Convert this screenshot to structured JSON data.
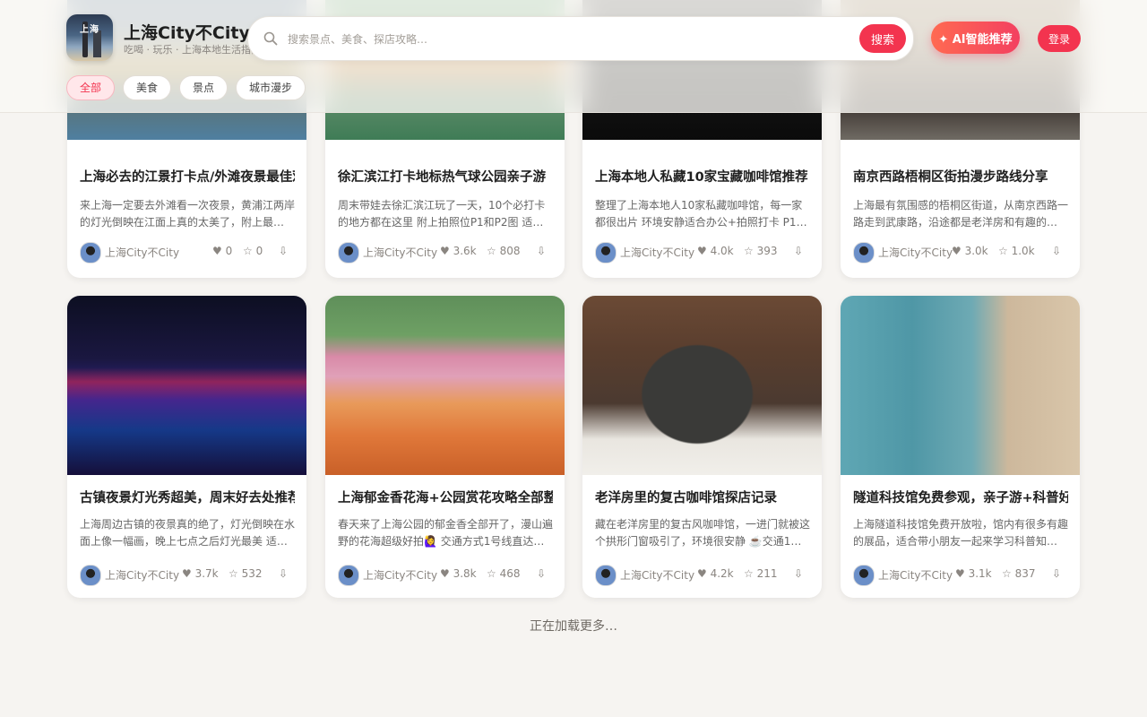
{
  "header": {
    "logo_text": "上海",
    "title": "上海City不City",
    "subtitle": "吃喝 · 玩乐 · 上海本地生活指南",
    "search_placeholder": "搜索景点、美食、探店攻略…",
    "search_button": "搜索",
    "ai_button": "✦ AI智能推荐",
    "login_button": "登录"
  },
  "chips": [
    {
      "label": "全部",
      "active": true
    },
    {
      "label": "美食"
    },
    {
      "label": "景点"
    },
    {
      "label": "城市漫步"
    }
  ],
  "colors": {
    "accent": "#f3344f",
    "background": "#f6f4f1"
  },
  "cards": [
    {
      "title": "上海必去的江景打卡点/外滩夜景最佳观景位",
      "desc": "来上海一定要去外滩看一次夜景，黄浦江两岸的灯光倒映在江面上真的太美了，附上最佳拍照机位和游玩路线，建议傍晚时分前往…",
      "author": "上海City不City",
      "likes": "♥ 0",
      "favs": "☆ 0",
      "download": "⇩"
    },
    {
      "title": "徐汇滨江打卡地标热气球公园亲子游",
      "desc": "周末带娃去徐汇滨江玩了一天，10个必打卡的地方都在这里 附上拍照位P1和P2图 适合所有人，545路 …",
      "author": "上海City不City",
      "likes": "♥ 3.6k",
      "favs": "☆ 808",
      "download": "⇩"
    },
    {
      "title": "上海本地人私藏10家宝藏咖啡馆推荐",
      "desc": "整理了上海本地人10家私藏咖啡馆，每一家都很出片 环境安静适合办公+拍照打卡 P1-P2 详细地址见图片 人均…",
      "author": "上海City不City",
      "likes": "♥ 4.0k",
      "favs": "☆ 393",
      "download": "⇩"
    },
    {
      "title": "南京西路梧桐区街拍漫步路线分享",
      "desc": "上海最有氛围感的梧桐区街道，从南京西路一路走到武康路，沿途都是老洋房和有趣的小店，非常适合周末慢慢逛，附上详细路线…",
      "author": "上海City不City",
      "likes": "♥ 3.0k",
      "favs": "☆ 1.0k",
      "download": "⇩"
    },
    {
      "title": "古镇夜景灯光秀超美，周末好去处推荐",
      "desc": "上海周边古镇的夜景真的绝了，灯光倒映在水面上像一幅画，晚上七点之后灯光最美 适合情侣约会+拍照打卡，门票…",
      "author": "上海City不City",
      "likes": "♥ 3.7k",
      "favs": "☆ 532",
      "download": "⇩"
    },
    {
      "title": "上海郁金香花海+公园赏花攻略全部整理好了",
      "desc": "春天来了上海公园的郁金香全部开了，漫山遍野的花海超级好拍🙋‍♀️ 交通方式1号线直达，2号线 P1P2 附拍照机位…",
      "author": "上海City不City",
      "likes": "♥ 3.8k",
      "favs": "☆ 468",
      "download": "⇩"
    },
    {
      "title": "老洋房里的复古咖啡馆探店记录",
      "desc": "藏在老洋房里的复古风咖啡馆，一进门就被这个拱形门窗吸引了，环境很安静 ☕️交通1号线陕西南路站，2号线 P1-P…",
      "author": "上海City不City",
      "likes": "♥ 4.2k",
      "favs": "☆ 211",
      "download": "⇩"
    },
    {
      "title": "隧道科技馆免费参观，亲子游+科普好去处",
      "desc": "上海隧道科技馆免费开放啦，馆内有很多有趣的展品，适合带小朋友一起来学习科普知识 需要提前在公众号预约 …",
      "author": "上海City不City",
      "likes": "♥ 3.1k",
      "favs": "☆ 837",
      "download": "⇩"
    }
  ],
  "loading_text": "正在加载更多…"
}
